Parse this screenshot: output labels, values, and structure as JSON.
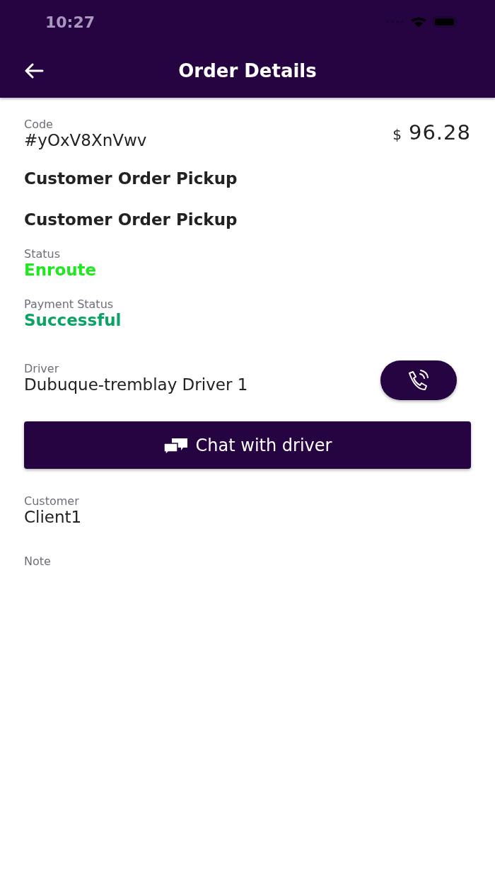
{
  "status_bar": {
    "time": "10:27"
  },
  "header": {
    "title": "Order Details"
  },
  "code": {
    "label": "Code",
    "value": "#yOxV8XnVwv"
  },
  "price": {
    "currency": "$",
    "amount": "96.28"
  },
  "titles": [
    "Customer Order Pickup",
    "Customer Order Pickup"
  ],
  "statuses": [
    {
      "label": "Status",
      "value": "Enroute",
      "color": "#1ee81e"
    },
    {
      "label": "Payment Status",
      "value": "Successful",
      "color": "#0ca366"
    }
  ],
  "driver": {
    "label": "Driver",
    "name": "Dubuque-tremblay Driver 1"
  },
  "chat_button": {
    "label": "Chat with driver"
  },
  "customer": {
    "label": "Customer",
    "value": "Client1"
  },
  "note": {
    "label": "Note"
  }
}
